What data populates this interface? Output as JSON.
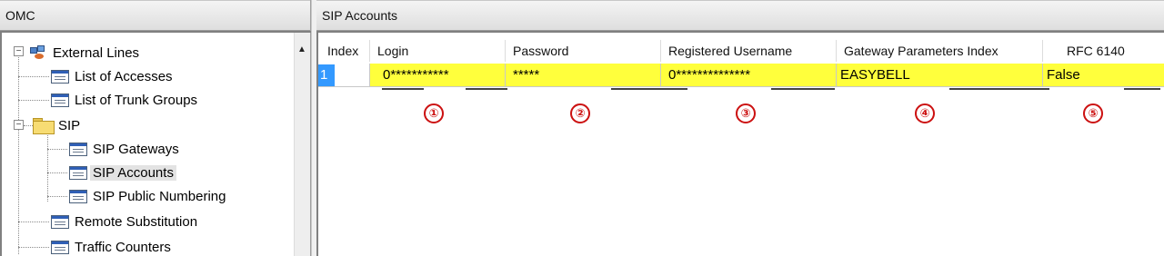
{
  "left_pane": {
    "title": "OMC",
    "tree": [
      {
        "label": "External Lines",
        "icon": "network-icon"
      },
      {
        "label": "List of Accesses",
        "icon": "list-icon"
      },
      {
        "label": "List of Trunk Groups",
        "icon": "list-icon"
      },
      {
        "label": "SIP",
        "icon": "folder-icon"
      },
      {
        "label": "SIP Gateways",
        "icon": "list-icon"
      },
      {
        "label": "SIP Accounts",
        "icon": "list-icon",
        "selected": true
      },
      {
        "label": "SIP Public Numbering",
        "icon": "list-icon"
      },
      {
        "label": "Remote Substitution",
        "icon": "list-icon"
      },
      {
        "label": "Traffic Counters",
        "icon": "list-icon"
      }
    ],
    "expanders": {
      "external_lines": "−",
      "sip": "−"
    },
    "scroll_up_glyph": "▲"
  },
  "right_pane": {
    "title": "SIP Accounts",
    "columns": [
      "Index",
      "Login",
      "Password",
      "Registered Username",
      "Gateway Parameters Index",
      "RFC 6140"
    ],
    "rows": [
      {
        "index": "1",
        "login": "0***********",
        "password": "*****",
        "registered_username": "0**************",
        "gateway_parameters_index": "EASYBELL",
        "rfc_6140": "False"
      }
    ],
    "markers": [
      "①",
      "②",
      "③",
      "④",
      "⑤"
    ]
  },
  "colors": {
    "row_highlight": "#ffff3c",
    "selection": "#3399ff",
    "marker": "#cc1111"
  }
}
